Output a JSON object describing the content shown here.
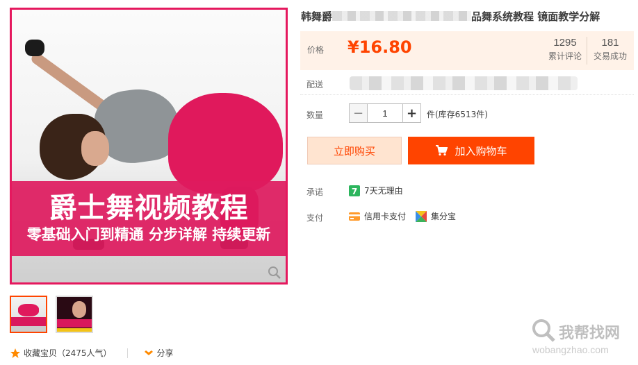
{
  "gallery": {
    "banner_title": "爵士舞视频教程",
    "banner_subtitle": "零基础入门到精通 分步详解 持续更新",
    "thumbnails": [
      {
        "name": "thumbnail-1",
        "active": true
      },
      {
        "name": "thumbnail-2",
        "active": false
      }
    ]
  },
  "social": {
    "favorite_label": "收藏宝贝（2475人气）",
    "share_label": "分享"
  },
  "product": {
    "title_start": "韩舞爵",
    "title_end": "品舞系统教程 镜面教学分解"
  },
  "price": {
    "label": "价格",
    "value": "¥16.80",
    "reviews_count": "1295",
    "reviews_label": "累计评论",
    "deals_count": "181",
    "deals_label": "交易成功"
  },
  "delivery": {
    "label": "配送"
  },
  "quantity": {
    "label": "数量",
    "value": "1",
    "stock_text": "件(库存6513件)"
  },
  "actions": {
    "buy_now": "立即购买",
    "add_to_cart": "加入购物车"
  },
  "promise": {
    "label": "承诺",
    "text": "7天无理由"
  },
  "payment": {
    "label": "支付",
    "methods": [
      "信用卡支付",
      "集分宝"
    ]
  },
  "watermark": {
    "text": "我帮找网",
    "url": "wobangzhao.com"
  },
  "colors": {
    "accent": "#ff4400",
    "banner_pink": "#de1a5e",
    "price_bg": "#fff2e8"
  }
}
